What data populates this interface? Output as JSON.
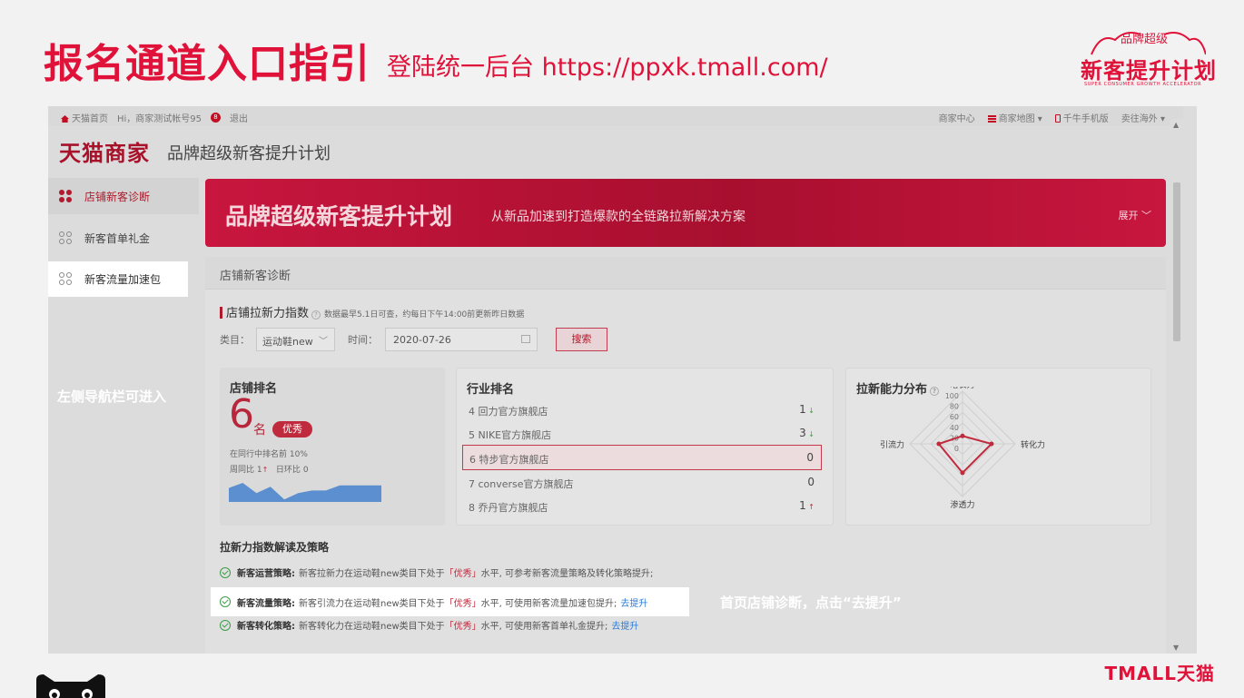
{
  "slide": {
    "title": "报名通道入口指引",
    "subtitle": "登陆统一后台 https://ppxk.tmall.com/",
    "brand_small": "品牌超级",
    "brand_big": "新客提升计划",
    "brand_en": "SUPER CONSUMER GROWTH ACCELERATOR",
    "footer_logo": "TMALL天猫",
    "accent": "#e0123a"
  },
  "topbar": {
    "home": "天猫首页",
    "greeting": "Hi，商家测试帐号95",
    "msg_count": "8",
    "logout": "退出",
    "right": [
      "商家中心",
      "商家地图",
      "千牛手机版",
      "卖往海外"
    ]
  },
  "header": {
    "logo": "天猫商家",
    "title": "品牌超级新客提升计划"
  },
  "sidebar": {
    "items": [
      {
        "label": "店铺新客诊断"
      },
      {
        "label": "新客首单礼金"
      },
      {
        "label": "新客流量加速包"
      }
    ],
    "note": "左侧导航栏可进入"
  },
  "banner": {
    "title": "品牌超级新客提升计划",
    "slogan": "从新品加速到打造爆款的全链路拉新解决方案",
    "expand": "展开"
  },
  "main": {
    "head": "店铺新客诊断",
    "section_title": "店铺拉新力指数",
    "section_note": "数据最早5.1日可查，约每日下午14:00前更新昨日数据",
    "filter_category_label": "类目：",
    "filter_category_value": "运动鞋new",
    "filter_time_label": "时间：",
    "filter_time_value": "2020-07-26",
    "search_button": "搜索"
  },
  "store_rank": {
    "title": "店铺排名",
    "rank": "6",
    "unit": "名",
    "badge": "优秀",
    "peer_text": "在同行中排名前 10%",
    "wow_label": "周同比",
    "wow_value": "1",
    "dod_label": "日环比",
    "dod_value": "0",
    "trend": [
      0.55,
      0.75,
      0.35,
      0.6,
      0.1,
      0.35,
      0.45,
      0.45,
      0.65,
      0.65,
      0.65,
      0.65
    ]
  },
  "industry_rank": {
    "title": "行业排名",
    "rows": [
      {
        "name": "4 回力官方旗舰店",
        "change": "1",
        "dir": "down"
      },
      {
        "name": "5 NIKE官方旗舰店",
        "change": "3",
        "dir": "down"
      },
      {
        "name": "6 特步官方旗舰店",
        "change": "0",
        "dir": "none"
      },
      {
        "name": "7 converse官方旗舰店",
        "change": "0",
        "dir": "none"
      },
      {
        "name": "8 乔丹官方旗舰店",
        "change": "1",
        "dir": "up"
      }
    ]
  },
  "chart_data": {
    "type": "radar",
    "title": "拉新能力分布",
    "axes": [
      "增长力",
      "转化力",
      "渗透力",
      "引流力"
    ],
    "ticks": [
      "100",
      "80",
      "60",
      "40",
      "20",
      "0"
    ],
    "rlim": [
      0,
      100
    ],
    "values": [
      15,
      55,
      55,
      45
    ],
    "color": "#c02a3d"
  },
  "strategy": {
    "title": "拉新力指数解读及策略",
    "items": [
      {
        "label": "新客运营策略:",
        "pre": "新客拉新力在运动鞋new类目下处于",
        "level": "「优秀」",
        "post": "水平, 可参考新客流量策略及转化策略提升;",
        "link": ""
      },
      {
        "label": "新客流量策略:",
        "pre": "新客引流力在运动鞋new类目下处于",
        "level": "「优秀」",
        "post": "水平, 可使用新客流量加速包提升;",
        "link": "去提升"
      },
      {
        "label": "新客转化策略:",
        "pre": "新客转化力在运动鞋new类目下处于",
        "level": "「优秀」",
        "post": "水平, 可使用新客首单礼金提升;",
        "link": "去提升"
      }
    ],
    "click_note": "首页店铺诊断，点击“去提升”"
  }
}
